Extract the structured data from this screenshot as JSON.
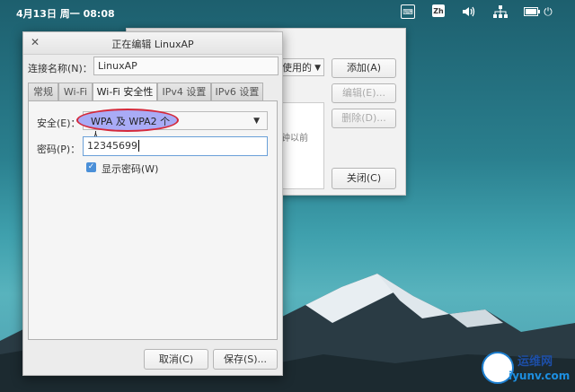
{
  "topbar": {
    "datetime": "4月13日 周一   08:08",
    "keyboard_icon": "keyboard-icon",
    "ime_label": "Zh",
    "volume_icon": "volume-icon",
    "network_icon": "network-icon",
    "battery_icon": "battery-icon",
    "power_icon": "power-icon"
  },
  "back_window": {
    "combo_value": "使用的",
    "list_hint": "钟以前",
    "add_button": "添加(A)",
    "edit_button": "编辑(E)...",
    "delete_button": "删除(D)...",
    "close_button": "关闭(C)"
  },
  "edit_window": {
    "title": "正在编辑 LinuxAP",
    "connection_name_label": "连接名称(N)：",
    "connection_name_value": "LinuxAP",
    "tabs": [
      {
        "label": "常规"
      },
      {
        "label": "Wi-Fi"
      },
      {
        "label": "Wi-Fi 安全性"
      },
      {
        "label": "IPv4 设置"
      },
      {
        "label": "IPv6 设置"
      }
    ],
    "active_tab": "Wi-Fi 安全性",
    "security_label": "安全(E)：",
    "security_value": "WPA 及 WPA2 个人",
    "password_label": "密码(P)：",
    "password_value": "12345699",
    "show_password_label": "显示密码(W)",
    "show_password_checked": true,
    "cancel_button": "取消(C)",
    "save_button": "保存(S)..."
  },
  "watermark": {
    "name": "运维网",
    "url": "iyunv.com"
  },
  "colors": {
    "highlight_fill": "#a9abf6",
    "highlight_border": "#d42a3c",
    "checkbox": "#4a8fd8"
  }
}
